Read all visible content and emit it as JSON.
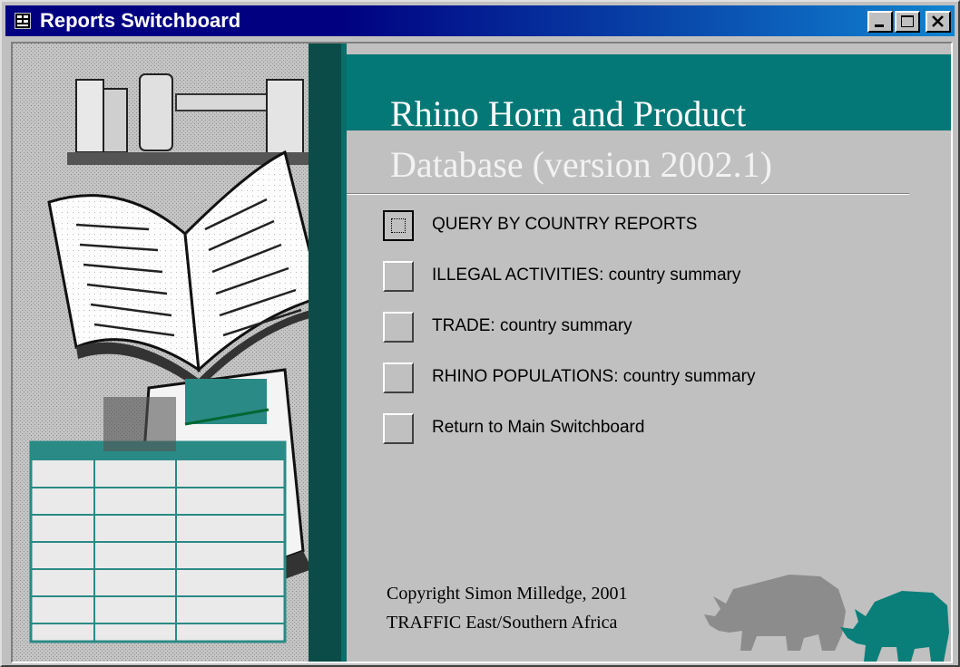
{
  "window": {
    "title": "Reports Switchboard",
    "controls": {
      "minimize": "minimize",
      "maximize": "maximize",
      "close": "close"
    }
  },
  "header": {
    "line1": "Rhino Horn and Product",
    "line2": "Database (version 2002.1)"
  },
  "menu": [
    {
      "label": "QUERY BY COUNTRY REPORTS",
      "focused": true
    },
    {
      "label": "ILLEGAL ACTIVITIES: country summary",
      "focused": false
    },
    {
      "label": "TRADE: country summary",
      "focused": false
    },
    {
      "label": "RHINO POPULATIONS: country summary",
      "focused": false
    },
    {
      "label": "Return to Main Switchboard",
      "focused": false
    }
  ],
  "footer": {
    "copyright": "Copyright Simon Milledge, 2001",
    "organization": "TRAFFIC East/Southern Africa"
  },
  "colors": {
    "titlebar": "#000080",
    "teal_header": "#047876",
    "face": "#c0c0c0",
    "rhino_gray": "#8c8c8c",
    "rhino_teal": "#0a7f7a"
  },
  "icons": {
    "app": "form-icon",
    "illustration": "books-illustration",
    "rhinos": [
      "rhino-gray-icon",
      "rhino-teal-icon"
    ]
  }
}
